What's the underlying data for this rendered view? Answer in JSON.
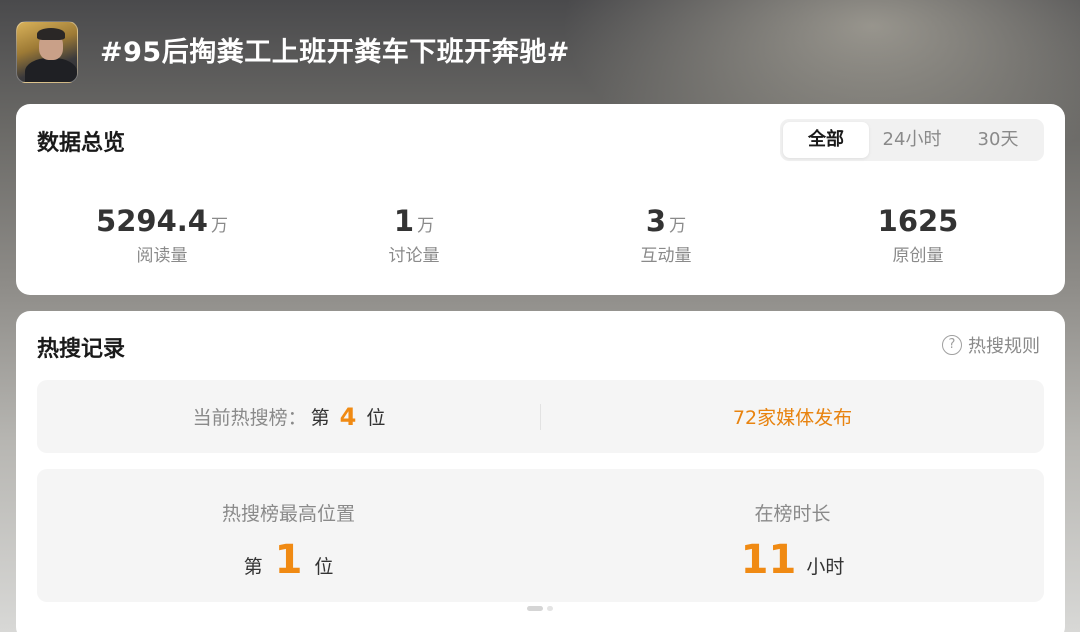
{
  "header": {
    "title": "#95后掏粪工上班开粪车下班开奔驰#"
  },
  "overview": {
    "title": "数据总览",
    "tabs": [
      {
        "label": "全部",
        "active": true
      },
      {
        "label": "24小时",
        "active": false
      },
      {
        "label": "30天",
        "active": false
      }
    ],
    "stats": [
      {
        "value": "5294.4",
        "unit": "万",
        "label": "阅读量"
      },
      {
        "value": "1",
        "unit": "万",
        "label": "讨论量"
      },
      {
        "value": "3",
        "unit": "万",
        "label": "互动量"
      },
      {
        "value": "1625",
        "unit": "",
        "label": "原创量"
      }
    ]
  },
  "hot": {
    "title": "热搜记录",
    "rules_label": "热搜规则",
    "rules_icon": "?",
    "current_label": "当前热搜榜：",
    "current_prefix": "第",
    "current_rank": "4",
    "current_suffix": "位",
    "media_text": "72家媒体发布",
    "highest_label": "热搜榜最高位置",
    "highest_prefix": "第",
    "highest_rank": "1",
    "highest_suffix": "位",
    "duration_label": "在榜时长",
    "duration_value": "11",
    "duration_unit": "小时"
  },
  "colors": {
    "accent_orange": "#f08a13",
    "text_dark": "#333333",
    "text_muted": "#8a8a8a"
  }
}
